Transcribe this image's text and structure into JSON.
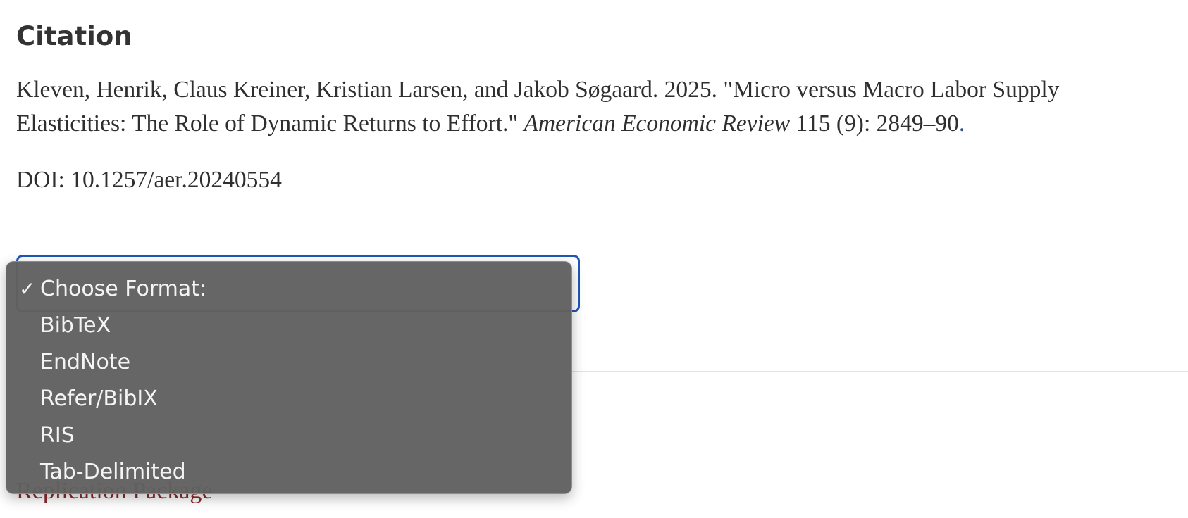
{
  "section": {
    "heading": "Citation"
  },
  "citation": {
    "text_before_journal": "Kleven, Henrik, Claus Kreiner, Kristian Larsen, and Jakob Søgaard. 2025. \"Micro versus Macro Labor Supply Elasticities: The Role of Dynamic Returns to Effort.\" ",
    "journal": "American Economic Review",
    "text_after_journal": " 115 (9): 2849–90",
    "trailing_link": ".",
    "doi": "DOI: 10.1257/aer.20240554"
  },
  "format_dropdown": {
    "selected_index": 0,
    "check_glyph": "✓",
    "options": [
      {
        "label": "Choose Format:"
      },
      {
        "label": "BibTeX"
      },
      {
        "label": "EndNote"
      },
      {
        "label": "Refer/BibIX"
      },
      {
        "label": "RIS"
      },
      {
        "label": "Tab-Delimited"
      }
    ]
  },
  "below_content": {
    "replication_link": "Replication Package"
  },
  "colors": {
    "select_focus_border": "#1f56b8",
    "menu_background": "#606060",
    "link": "#8c2a2e",
    "body_text": "#2f2f2f"
  }
}
